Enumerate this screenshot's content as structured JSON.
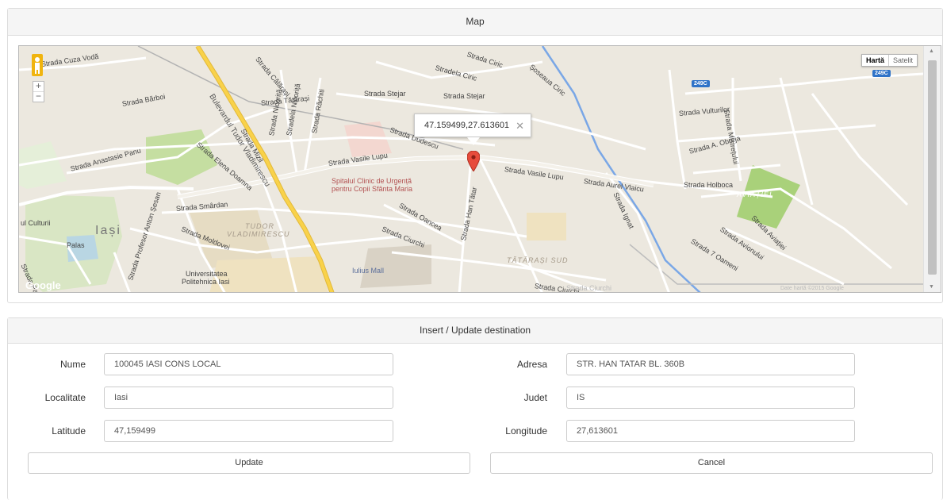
{
  "map_panel": {
    "title": "Map",
    "map_type": {
      "active": "Hartă",
      "inactive": "Satelit"
    },
    "zoom": {
      "in": "+",
      "out": "−"
    },
    "info_window": {
      "text": "47.159499,27.613601",
      "close": "✕"
    },
    "highway_shields": [
      "249C",
      "249C"
    ],
    "labels": {
      "strada_cuza_voda": "Strada Cuza Vodă",
      "strada_calarasi": "Strada Călărași",
      "strada_barboi": "Strada Bărboi",
      "strada_tatarasi": "Strada Tătărași",
      "strada_stejar": "Strada Stejar",
      "strada_stejar2": "Strada Stejar",
      "stradela_ciric": "Stradela Ciric",
      "strada_ciric": "Strada Ciric",
      "soseaua_ciric": "Șoseaua Ciric",
      "bulevardul": "Bulevardul Tudor Vladimirescu",
      "strada_anastasie_panu": "Strada Anastasie Panu",
      "strada_mizil": "Strada Mizil",
      "strada_nicorita": "Strada Nicoriță",
      "stradela_nicorita": "Stradela Nicoriță",
      "strada_rachiti": "Strada Răchiti",
      "strada_elena_doamna": "Strada Elena Doamna",
      "strada_dudescu": "Strada Dudescu",
      "strada_vasile_lupu": "Strada Vasile Lupu",
      "strada_vasile_lupu2": "Strada Vasile Lupu",
      "spital1": "Spitalul Clinic de Urgență",
      "spital2": "pentru Copii Sfânta Maria",
      "strada_smardan": "Strada Smârdan",
      "strada_oancea": "Strada Oancea",
      "strada_han_tatar": "Strada Han Tătar",
      "strada_aurel_vlaicu": "Strada Aurel Vlaicu",
      "strada_ignat": "Strada Ignat",
      "strada_vulturilor": "Strada Vulturilor",
      "strada_mistretului": "Strada Mistrețului",
      "strada_a_obreja": "Strada A. Obreja",
      "strada_holboca": "Strada Holboca",
      "aviatiei": "AVIAȚIEI",
      "strada_aviatiei": "Strada Aviației",
      "strada_avionului": "Strada Avionului",
      "strada_7_oameni": "Strada 7 Oameni",
      "palatul_culturii": "ul Culturii",
      "iasi": "Iași",
      "palas": "Palas",
      "strada_moldovei": "Strada Moldovei",
      "strada_anton_sesan": "Strada Profesor Anton Șesan",
      "tudor_vladimirescu": "TUDOR",
      "tudor_vladimirescu2": "VLADIMIRESCU",
      "strada_ciurchi": "Strada Ciurchi",
      "strada_ciurchi2": "Strada Ciurchi",
      "strada_ciurchi3": "Strada Ciurchi",
      "tatarasi_sud": "TĂTĂRAȘI SUD",
      "iulius_mall": "Iulius Mall",
      "universitatea": "Universitatea",
      "politehnica": "Politehnica Iasi",
      "strada_palat": "Strada Palat",
      "google": "Google",
      "attribution": "Date hartă ©2015 Google"
    }
  },
  "destination_panel": {
    "title": "Insert / Update destination",
    "fields": {
      "nume": {
        "label": "Nume",
        "value": "100045 IASI CONS LOCAL"
      },
      "adresa": {
        "label": "Adresa",
        "value": "STR. HAN TATAR BL. 360B"
      },
      "localitate": {
        "label": "Localitate",
        "value": "Iasi"
      },
      "judet": {
        "label": "Judet",
        "value": "IS"
      },
      "latitude": {
        "label": "Latitude",
        "value": "47,159499"
      },
      "longitude": {
        "label": "Longitude",
        "value": "27,613601"
      }
    },
    "buttons": {
      "update": "Update",
      "cancel": "Cancel"
    }
  },
  "colors": {
    "road_major": "#f9d24a",
    "road_minor": "#ffffff",
    "map_bg": "#ece8df",
    "park": "#c5dea1",
    "water": "#7aa7e6",
    "marker": "#e74c3c",
    "highway_shield": "#2f73c8"
  }
}
